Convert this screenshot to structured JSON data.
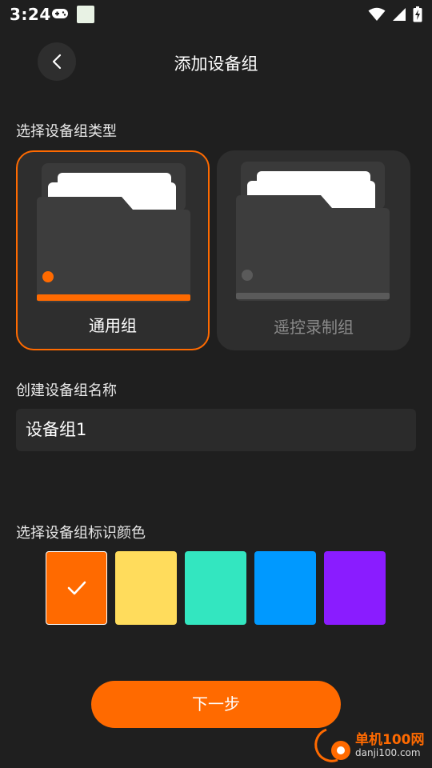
{
  "status_bar": {
    "time": "3:24",
    "icons": [
      "gamepad-icon",
      "app-notification-icon",
      "wifi-icon",
      "signal-icon",
      "battery-charging-icon"
    ]
  },
  "header": {
    "title": "添加设备组",
    "back_icon": "chevron-left-icon"
  },
  "group_type": {
    "label": "选择设备组类型",
    "options": [
      {
        "label": "通用组",
        "selected": true,
        "accent": "#ff6a00"
      },
      {
        "label": "遥控录制组",
        "selected": false,
        "accent": "#5a5a5a"
      }
    ]
  },
  "group_name": {
    "label": "创建设备组名称",
    "value": "设备组1"
  },
  "color_picker": {
    "label": "选择设备组标识颜色",
    "colors": [
      "#ff6a00",
      "#ffdc5c",
      "#33e6c0",
      "#0099ff",
      "#8a1cff"
    ],
    "selected_index": 0
  },
  "next_button": {
    "label": "下一步"
  },
  "watermark": {
    "text": "单机100网",
    "url": "danji100.com"
  }
}
